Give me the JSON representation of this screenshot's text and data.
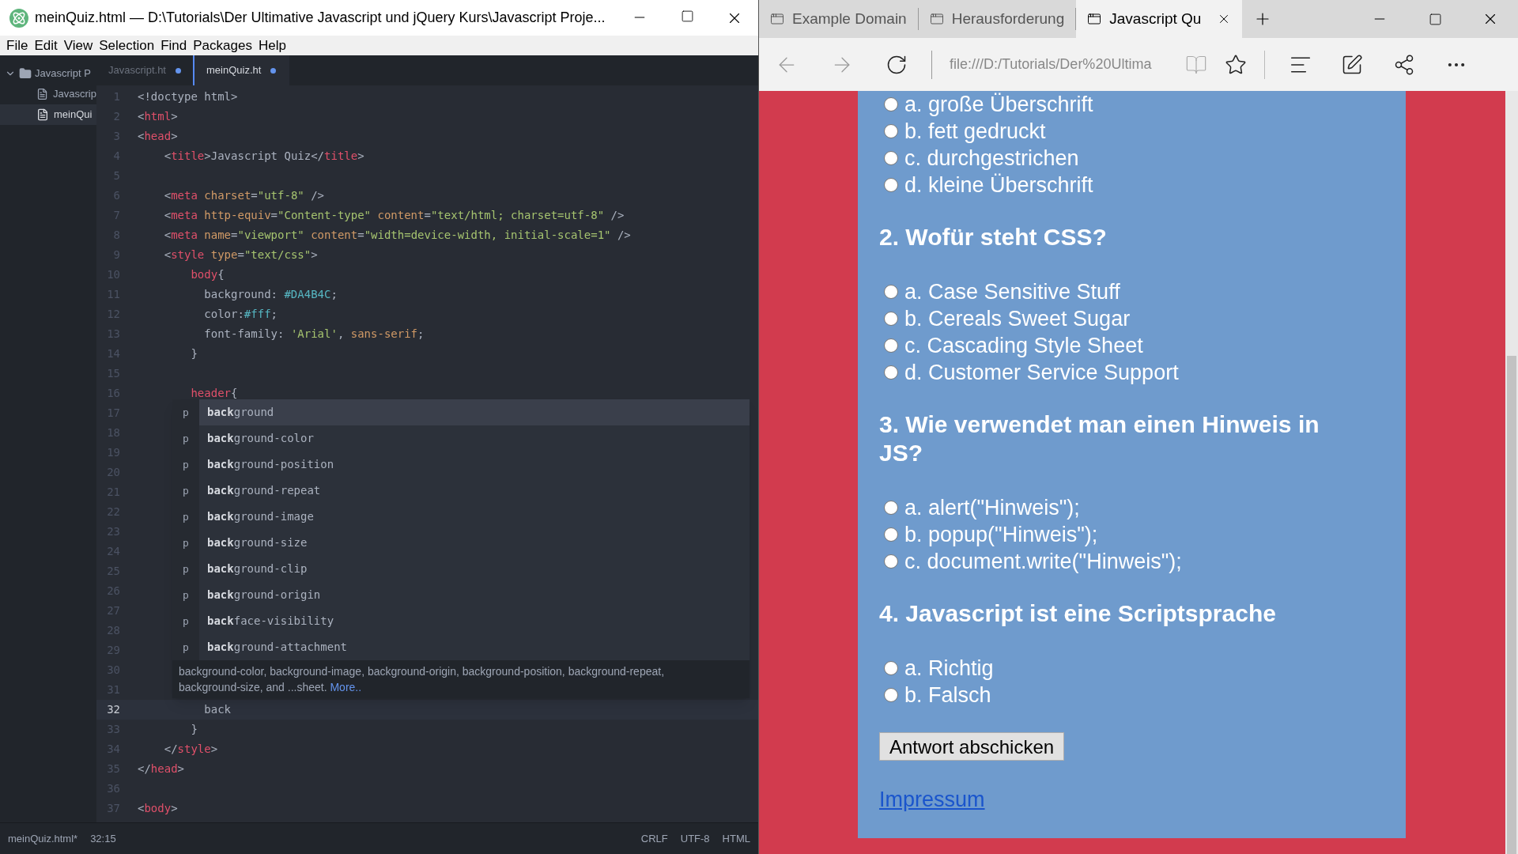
{
  "editor": {
    "window_title": "meinQuiz.html — D:\\Tutorials\\Der Ultimative Javascript und jQuery Kurs\\Javascript Proje...",
    "menu": [
      "File",
      "Edit",
      "View",
      "Selection",
      "Find",
      "Packages",
      "Help"
    ],
    "tree": {
      "folder": "Javascript P",
      "expanded": true,
      "files": [
        {
          "name": "Javascrip",
          "selected": false
        },
        {
          "name": "meinQui",
          "selected": true
        }
      ]
    },
    "tabs": [
      {
        "label": "Javascript.ht",
        "selected": false,
        "modified": true
      },
      {
        "label": "meinQuiz.ht",
        "selected": true,
        "modified": true
      }
    ],
    "lines": [
      {
        "number": "1",
        "current": false,
        "tokens": [
          {
            "kind": "p",
            "text": "<!doctype html>"
          }
        ]
      },
      {
        "number": "2",
        "current": false,
        "tokens": [
          {
            "kind": "p",
            "text": "<"
          },
          {
            "kind": "tag",
            "text": "html"
          },
          {
            "kind": "p",
            "text": ">"
          }
        ]
      },
      {
        "number": "3",
        "current": false,
        "tokens": [
          {
            "kind": "p",
            "text": "<"
          },
          {
            "kind": "tag",
            "text": "head"
          },
          {
            "kind": "p",
            "text": ">"
          }
        ]
      },
      {
        "number": "4",
        "current": false,
        "tokens": [
          {
            "kind": "p",
            "text": "    <"
          },
          {
            "kind": "tag",
            "text": "title"
          },
          {
            "kind": "p",
            "text": ">Javascript Quiz</"
          },
          {
            "kind": "tag",
            "text": "title"
          },
          {
            "kind": "p",
            "text": ">"
          }
        ]
      },
      {
        "number": "5",
        "current": false
      },
      {
        "number": "6",
        "current": false,
        "tokens": [
          {
            "kind": "p",
            "text": "    <"
          },
          {
            "kind": "tag",
            "text": "meta"
          },
          {
            "kind": "attr",
            "text": " charset"
          },
          {
            "kind": "p",
            "text": "="
          },
          {
            "kind": "str",
            "text": "\"utf-8\""
          },
          {
            "kind": "p",
            "text": " />"
          }
        ]
      },
      {
        "number": "7",
        "current": false,
        "tokens": [
          {
            "kind": "p",
            "text": "    <"
          },
          {
            "kind": "tag",
            "text": "meta"
          },
          {
            "kind": "attr",
            "text": " http-equiv"
          },
          {
            "kind": "p",
            "text": "="
          },
          {
            "kind": "str",
            "text": "\"Content-type\""
          },
          {
            "kind": "attr",
            "text": " content"
          },
          {
            "kind": "p",
            "text": "="
          },
          {
            "kind": "str",
            "text": "\"text/html; charset=utf-8\""
          },
          {
            "kind": "p",
            "text": " />"
          }
        ]
      },
      {
        "number": "8",
        "current": false,
        "tokens": [
          {
            "kind": "p",
            "text": "    <"
          },
          {
            "kind": "tag",
            "text": "meta"
          },
          {
            "kind": "attr",
            "text": " name"
          },
          {
            "kind": "p",
            "text": "="
          },
          {
            "kind": "str",
            "text": "\"viewport\""
          },
          {
            "kind": "attr",
            "text": " content"
          },
          {
            "kind": "p",
            "text": "="
          },
          {
            "kind": "str",
            "text": "\"width=device-width, initial-scale=1\""
          },
          {
            "kind": "p",
            "text": " />"
          }
        ]
      },
      {
        "number": "9",
        "current": false,
        "tokens": [
          {
            "kind": "p",
            "text": "    <"
          },
          {
            "kind": "tag",
            "text": "style"
          },
          {
            "kind": "attr",
            "text": " type"
          },
          {
            "kind": "p",
            "text": "="
          },
          {
            "kind": "str",
            "text": "\"text/css\""
          },
          {
            "kind": "p",
            "text": ">"
          }
        ]
      },
      {
        "number": "10",
        "current": false,
        "tokens": [
          {
            "kind": "tag",
            "text": "        body"
          },
          {
            "kind": "p",
            "text": "{"
          }
        ]
      },
      {
        "number": "11",
        "current": false,
        "tokens": [
          {
            "kind": "p",
            "text": "          background: "
          },
          {
            "kind": "color",
            "text": "#DA4B4C"
          },
          {
            "kind": "p",
            "text": ";"
          }
        ]
      },
      {
        "number": "12",
        "current": false,
        "tokens": [
          {
            "kind": "p",
            "text": "          color:"
          },
          {
            "kind": "color",
            "text": "#fff"
          },
          {
            "kind": "p",
            "text": ";"
          }
        ]
      },
      {
        "number": "13",
        "current": false,
        "tokens": [
          {
            "kind": "p",
            "text": "          font-family: "
          },
          {
            "kind": "str",
            "text": "'Arial'"
          },
          {
            "kind": "p",
            "text": ", "
          },
          {
            "kind": "attr",
            "text": "sans-serif"
          },
          {
            "kind": "p",
            "text": ";"
          }
        ]
      },
      {
        "number": "14",
        "current": false,
        "tokens": [
          {
            "kind": "p",
            "text": "        }"
          }
        ]
      },
      {
        "number": "15",
        "current": false
      },
      {
        "number": "16",
        "current": false,
        "tokens": [
          {
            "kind": "tag",
            "text": "        header"
          },
          {
            "kind": "p",
            "text": "{"
          }
        ]
      },
      {
        "number": "17",
        "current": false
      },
      {
        "number": "18",
        "current": false
      },
      {
        "number": "19",
        "current": false
      },
      {
        "number": "20",
        "current": false
      },
      {
        "number": "21",
        "current": false
      },
      {
        "number": "22",
        "current": false
      },
      {
        "number": "23",
        "current": false
      },
      {
        "number": "24",
        "current": false
      },
      {
        "number": "25",
        "current": false
      },
      {
        "number": "26",
        "current": false
      },
      {
        "number": "27",
        "current": false
      },
      {
        "number": "28",
        "current": false
      },
      {
        "number": "29",
        "current": false
      },
      {
        "number": "30",
        "current": false
      },
      {
        "number": "31",
        "current": false
      },
      {
        "number": "32",
        "current": true,
        "tokens": [
          {
            "kind": "p",
            "text": "          back"
          }
        ]
      },
      {
        "number": "33",
        "current": false,
        "tokens": [
          {
            "kind": "p",
            "text": "        }"
          }
        ]
      },
      {
        "number": "34",
        "current": false,
        "tokens": [
          {
            "kind": "p",
            "text": "    </"
          },
          {
            "kind": "tag",
            "text": "style"
          },
          {
            "kind": "p",
            "text": ">"
          }
        ]
      },
      {
        "number": "35",
        "current": false,
        "tokens": [
          {
            "kind": "p",
            "text": "</"
          },
          {
            "kind": "tag",
            "text": "head"
          },
          {
            "kind": "p",
            "text": ">"
          }
        ]
      },
      {
        "number": "36",
        "current": false
      },
      {
        "number": "37",
        "current": false,
        "tokens": [
          {
            "kind": "p",
            "text": "<"
          },
          {
            "kind": "tag",
            "text": "body"
          },
          {
            "kind": "p",
            "text": ">"
          }
        ]
      }
    ],
    "autocomplete": {
      "items": [
        {
          "type": "p",
          "match": "back",
          "rest": "ground",
          "selected": true
        },
        {
          "type": "p",
          "match": "back",
          "rest": "ground-color",
          "selected": false
        },
        {
          "type": "p",
          "match": "back",
          "rest": "ground-position",
          "selected": false
        },
        {
          "type": "p",
          "match": "back",
          "rest": "ground-repeat",
          "selected": false
        },
        {
          "type": "p",
          "match": "back",
          "rest": "ground-image",
          "selected": false
        },
        {
          "type": "p",
          "match": "back",
          "rest": "ground-size",
          "selected": false
        },
        {
          "type": "p",
          "match": "back",
          "rest": "ground-clip",
          "selected": false
        },
        {
          "type": "p",
          "match": "back",
          "rest": "ground-origin",
          "selected": false
        },
        {
          "type": "p",
          "match": "back",
          "rest": "face-visibility",
          "selected": false
        },
        {
          "type": "p",
          "match": "back",
          "rest": "ground-attachment",
          "selected": false
        }
      ],
      "description": "background-color, background-image, background-origin, background-position, background-repeat, background-size, and ...sheet.",
      "more_link": "More.."
    },
    "status_bar": {
      "file": "meinQuiz.html*",
      "cursor": "32:15",
      "line_ending": "CRLF",
      "encoding": "UTF-8",
      "grammar": "HTML"
    }
  },
  "browser": {
    "tabs": [
      {
        "label": "Example Domain",
        "selected": false
      },
      {
        "label": "Herausforderung",
        "selected": false
      },
      {
        "label": "Javascript Qu",
        "selected": true
      }
    ],
    "address": "file:///D:/Tutorials/Der%20Ultima",
    "page": {
      "questions": [
        {
          "options": [
            {
              "label": "a. große Überschrift",
              "selected": false
            },
            {
              "label": "b. fett gedruckt",
              "selected": false
            },
            {
              "label": "c. durchgestrichen",
              "selected": false
            },
            {
              "label": "d. kleine Überschrift",
              "selected": false
            }
          ]
        },
        {
          "title": "2. Wofür steht CSS?",
          "options": [
            {
              "label": "a. Case Sensitive Stuff",
              "selected": false
            },
            {
              "label": "b. Cereals Sweet Sugar",
              "selected": false
            },
            {
              "label": "c. Cascading Style Sheet",
              "selected": false
            },
            {
              "label": "d. Customer Service Support",
              "selected": false
            }
          ]
        },
        {
          "title": "3. Wie verwendet man einen Hinweis in JS?",
          "options": [
            {
              "label": "a. alert(\"Hinweis\");",
              "selected": false
            },
            {
              "label": "b. popup(\"Hinweis\");",
              "selected": false
            },
            {
              "label": "c. document.write(\"Hinweis\");",
              "selected": false
            }
          ]
        },
        {
          "title": "4. Javascript ist eine Scriptsprache",
          "options": [
            {
              "label": "a. Richtig",
              "selected": false
            },
            {
              "label": "b. Falsch",
              "selected": false
            }
          ]
        }
      ],
      "submit": "Antwort abschicken",
      "footer_link": "Impressum"
    }
  }
}
